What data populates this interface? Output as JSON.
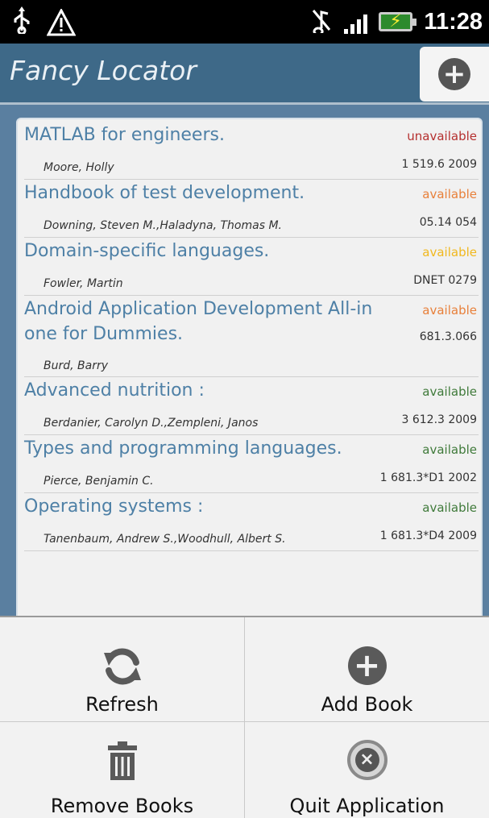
{
  "status_bar": {
    "time": "11:28",
    "icons": [
      "usb-icon",
      "warning-icon",
      "mute-icon",
      "signal-icon",
      "battery-icon"
    ]
  },
  "header": {
    "title": "Fancy Locator",
    "add_icon": "plus-circle-icon"
  },
  "books": [
    {
      "title": "MATLAB for engineers.",
      "status": "unavailable",
      "status_color": "#b5302f",
      "author": "Moore, Holly",
      "call_number": "1 519.6 2009"
    },
    {
      "title": "Handbook of test development.",
      "status": "available",
      "status_color": "#e8803a",
      "author": "Downing, Steven M.,Haladyna, Thomas M.",
      "call_number": "05.14 054"
    },
    {
      "title": "Domain-specific languages.",
      "status": "available",
      "status_color": "#f1b81e",
      "author": "Fowler, Martin",
      "call_number": "DNET 0279"
    },
    {
      "title": "Android Application Development All-in one for Dummies.",
      "status": "available",
      "status_color": "#e8803a",
      "author": "Burd, Barry",
      "call_number": "681.3.066"
    },
    {
      "title": "Advanced nutrition :",
      "status": "available",
      "status_color": "#3f7a3a",
      "author": "Berdanier, Carolyn D.,Zempleni, Janos",
      "call_number": "3 612.3 2009"
    },
    {
      "title": "Types and programming languages.",
      "status": "available",
      "status_color": "#3f7a3a",
      "author": "Pierce, Benjamin C.",
      "call_number": "1 681.3*D1 2002"
    },
    {
      "title": "Operating systems :",
      "status": "available",
      "status_color": "#3f7a3a",
      "author": "Tanenbaum, Andrew S.,Woodhull, Albert S.",
      "call_number": "1 681.3*D4 2009"
    }
  ],
  "menu": {
    "refresh": "Refresh",
    "add_book": "Add Book",
    "remove_books": "Remove Books",
    "quit": "Quit Application"
  }
}
